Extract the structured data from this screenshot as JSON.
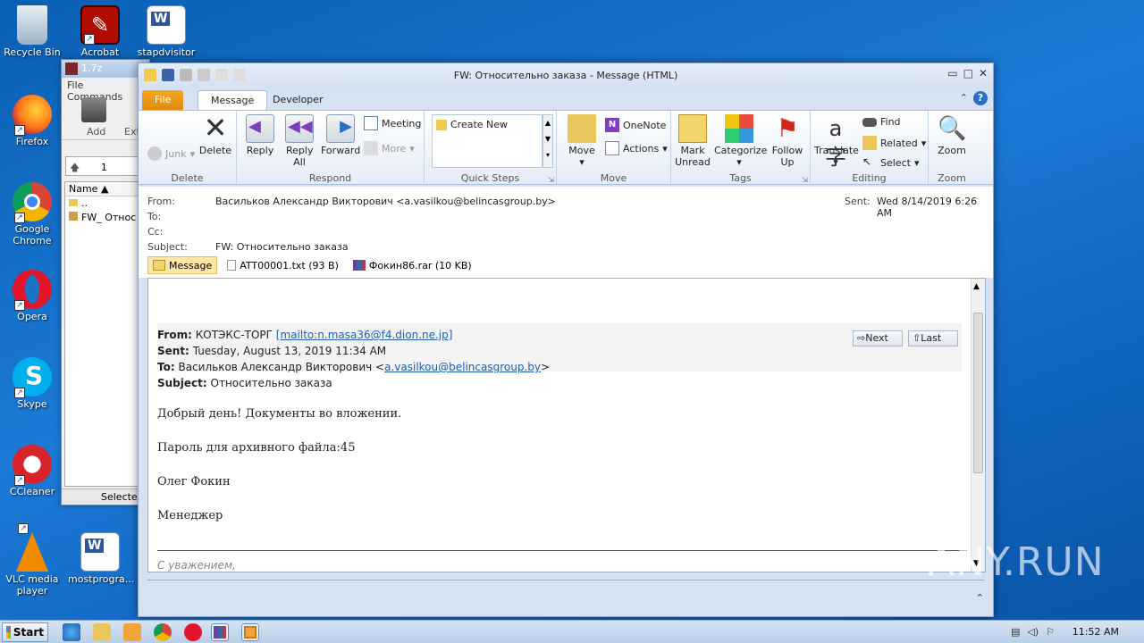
{
  "desktop": {
    "icons": [
      {
        "label": "Recycle Bin"
      },
      {
        "label": "Acrobat"
      },
      {
        "label": "stapdvisitor"
      },
      {
        "label": "Firefox"
      },
      {
        "label": "Google Chrome"
      },
      {
        "label": "Opera"
      },
      {
        "label": "Skype"
      },
      {
        "label": "CCleaner"
      },
      {
        "label": "VLC media player"
      },
      {
        "label": "mostprogra..."
      }
    ]
  },
  "zip_window": {
    "title": "1.7z",
    "menu": [
      "File",
      "Commands"
    ],
    "tools": [
      "Add",
      "Ext"
    ],
    "path_value": "1",
    "column_name": "Name",
    "rows": [
      "..",
      "FW_ Относ"
    ],
    "status": "Selected"
  },
  "outlook": {
    "title": "FW: Относительно заказа - Message (HTML)",
    "tabs": {
      "file": "File",
      "message": "Message",
      "developer": "Developer"
    },
    "ribbon": {
      "delete_group": {
        "label": "Delete",
        "junk": "Junk",
        "delete": "Delete"
      },
      "respond_group": {
        "label": "Respond",
        "reply": "Reply",
        "reply_all": "Reply All",
        "forward": "Forward",
        "meeting": "Meeting",
        "more": "More"
      },
      "quicksteps_group": {
        "label": "Quick Steps",
        "create_new": "Create New"
      },
      "move_group": {
        "label": "Move",
        "move": "Move",
        "onenote": "OneNote",
        "actions": "Actions"
      },
      "tags_group": {
        "label": "Tags",
        "mark_unread": "Mark Unread",
        "categorize": "Categorize",
        "follow_up": "Follow Up"
      },
      "editing_group": {
        "label": "Editing",
        "translate": "Translate",
        "find": "Find",
        "related": "Related",
        "select": "Select"
      },
      "zoom_group": {
        "label": "Zoom",
        "zoom": "Zoom"
      }
    },
    "header": {
      "from_label": "From:",
      "from_value": "Васильков Александр Викторович <a.vasilkou@belincasgroup.by>",
      "to_label": "To:",
      "cc_label": "Cc:",
      "subject_label": "Subject:",
      "subject_value": "FW: Относительно заказа",
      "sent_label": "Sent:",
      "sent_value": "Wed 8/14/2019 6:26 AM"
    },
    "attachments": [
      {
        "name": "Message"
      },
      {
        "name": "ATT00001.txt (93 B)"
      },
      {
        "name": "Фокин86.rar (10 KB)"
      }
    ],
    "body": {
      "fwd_from_label": "From:",
      "fwd_from_name": "КОТЭКС-ТОРГ",
      "fwd_from_link": "[mailto:n.masa36@f4.dion.ne.jp]",
      "fwd_sent_label": "Sent:",
      "fwd_sent_value": "Tuesday, August 13, 2019 11:34 AM",
      "fwd_to_label": "To:",
      "fwd_to_name": "Васильков Александр Викторович <",
      "fwd_to_link": "a.vasilkou@belincasgroup.by",
      "fwd_to_close": ">",
      "fwd_subject_label": "Subject:",
      "fwd_subject_value": "Относительно заказа",
      "next": "Next",
      "last": "Last",
      "line1": "Добрый день! Документы во вложении.",
      "line2": "Пароль для архивного файла:45",
      "line3": "Олег Фокин",
      "line4": "Менеджер",
      "signature": "С уважением,"
    }
  },
  "taskbar": {
    "start": "Start",
    "clock": "11:52 AM"
  },
  "watermark": "ANY.RUN"
}
